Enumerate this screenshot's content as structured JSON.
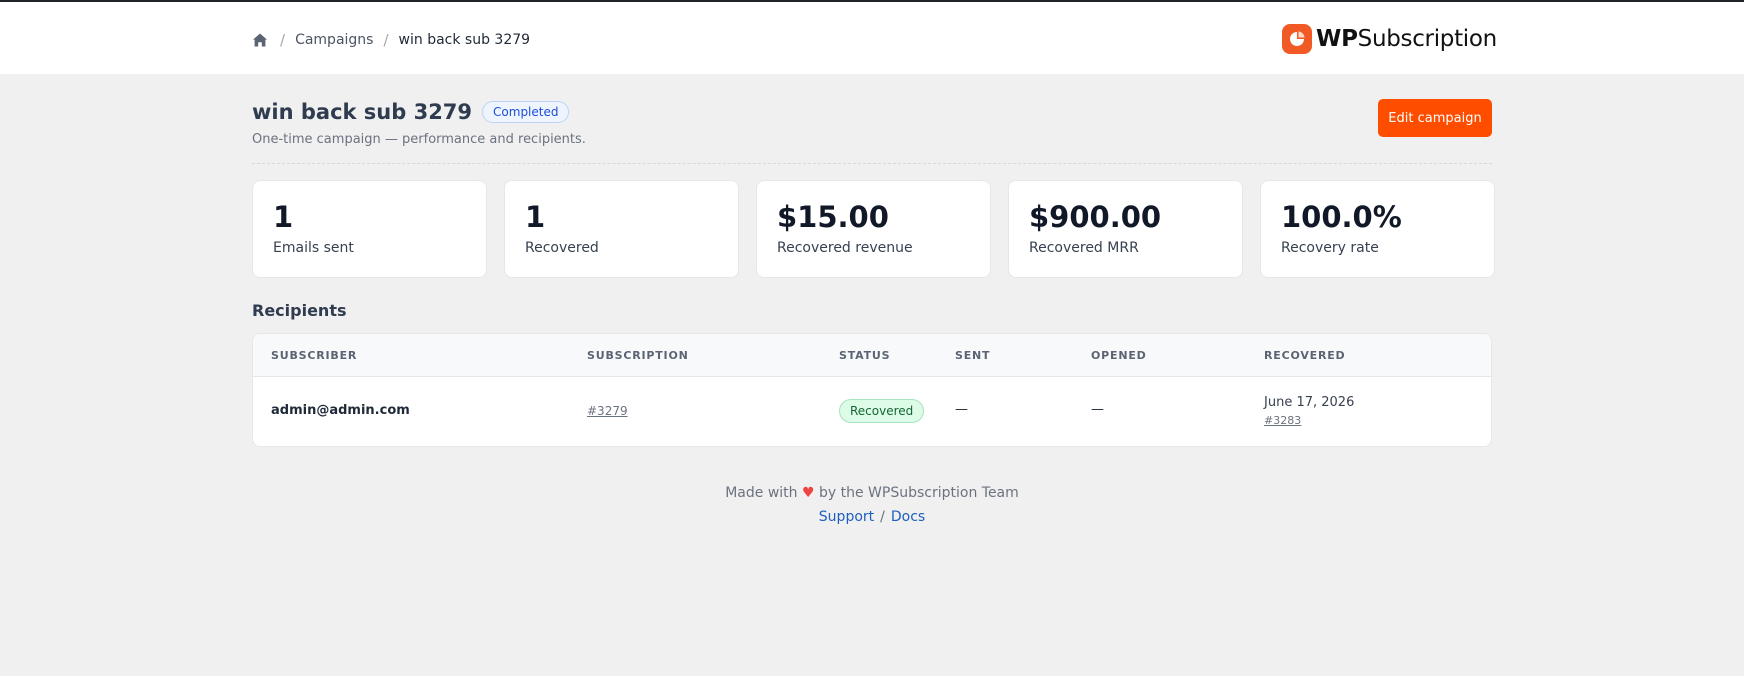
{
  "breadcrumb": {
    "home_icon": "home-icon",
    "separator": "/",
    "campaigns": "Campaigns",
    "current": "win back sub 3279"
  },
  "logo": {
    "mark_icon": "wpsubscription-logo-icon",
    "bold": "WP",
    "regular": "Subscription"
  },
  "campaign": {
    "title": "win back sub 3279",
    "status": "Completed",
    "subtitle": "One-time campaign — performance and recipients.",
    "edit_label": "Edit campaign"
  },
  "stats": [
    {
      "value": "1",
      "label": "Emails sent"
    },
    {
      "value": "1",
      "label": "Recovered"
    },
    {
      "value": "$15.00",
      "label": "Recovered revenue"
    },
    {
      "value": "$900.00",
      "label": "Recovered MRR"
    },
    {
      "value": "100.0%",
      "label": "Recovery rate"
    }
  ],
  "recipients": {
    "title": "Recipients",
    "columns": [
      "SUBSCRIBER",
      "SUBSCRIPTION",
      "STATUS",
      "SENT",
      "OPENED",
      "RECOVERED"
    ],
    "rows": [
      {
        "subscriber": "admin@admin.com",
        "subscription": "#3279",
        "status": "Recovered",
        "sent": "—",
        "opened": "—",
        "recovered_date": "June 17, 2026",
        "recovered_order": "#3283"
      }
    ]
  },
  "footer": {
    "made_with": "Made with",
    "heart": "♥",
    "by_team": "by the WPSubscription Team",
    "support": "Support",
    "slash": "/",
    "docs": "Docs"
  },
  "colors": {
    "accent": "#ff4d00",
    "logo": "#f15a24",
    "status_blue": "#1d4ed8",
    "status_green": "#166534",
    "link": "#1d5fbf"
  }
}
